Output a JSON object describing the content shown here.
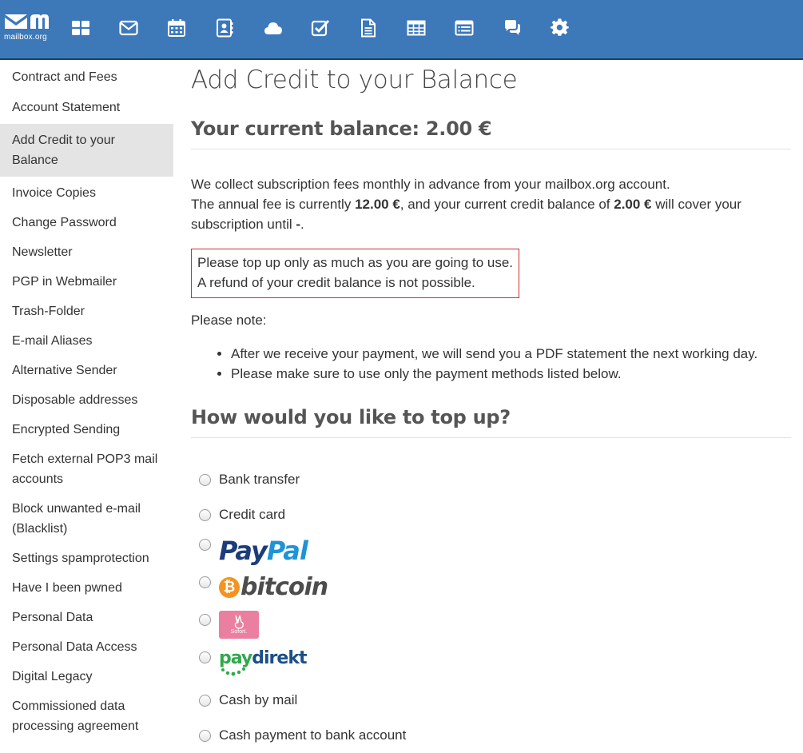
{
  "app": {
    "logo_text": "mailbox.org",
    "accent_color": "#3d78b9",
    "toolbar_icons": [
      "dashboard-icon",
      "mail-icon",
      "calendar-icon",
      "contacts-icon",
      "cloud-icon",
      "tasks-icon",
      "document-icon",
      "spreadsheet-icon",
      "presentation-icon",
      "chat-icon",
      "settings-icon"
    ]
  },
  "sidebar": {
    "items": [
      {
        "label": "Contract and Fees"
      },
      {
        "label": "Account Statement"
      },
      {
        "label": "Add Credit to your Balance",
        "active": true
      },
      {
        "label": "Invoice Copies"
      },
      {
        "label": "Change Password"
      },
      {
        "label": "Newsletter"
      },
      {
        "label": "PGP in Webmailer"
      },
      {
        "label": "Trash-Folder"
      },
      {
        "label": "E-mail Aliases"
      },
      {
        "label": "Alternative Sender"
      },
      {
        "label": "Disposable addresses"
      },
      {
        "label": "Encrypted Sending"
      },
      {
        "label": "Fetch external POP3 mail accounts"
      },
      {
        "label": "Block unwanted e-mail (Blacklist)"
      },
      {
        "label": "Settings spamprotection"
      },
      {
        "label": "Have I been pwned"
      },
      {
        "label": "Personal Data"
      },
      {
        "label": "Personal Data Access"
      },
      {
        "label": "Digital Legacy"
      },
      {
        "label": "Commissioned data processing agreement"
      }
    ]
  },
  "main": {
    "title": "Add Credit to your Balance",
    "balance_heading": "Your current balance: 2.00 €",
    "intro_line1": "We collect subscription fees monthly in advance from your mailbox.org account.",
    "intro_line2_a": "The annual fee is currently ",
    "annual_fee": "12.00 €",
    "intro_line2_b": ", and your current credit balance of ",
    "credit_balance": "2.00 €",
    "intro_line2_c": " will cover your subscription until ",
    "until_value": "-",
    "intro_line2_d": ".",
    "warning_line1": "Please top up only as much as you are going to use.",
    "warning_line2": "A refund of your credit balance is not possible.",
    "note_label": "Please note:",
    "bullets": [
      "After we receive your payment, we will send you a PDF statement the next working day.",
      "Please make sure to use only the payment methods listed below."
    ],
    "topup_heading": "How would you like to top up?",
    "payment_options": {
      "bank_transfer": "Bank transfer",
      "credit_card": "Credit card",
      "paypal_logo": "PayPal",
      "bitcoin_logo": "bitcoin",
      "sofort_logo": "Sofort.",
      "paydirekt_logo": "paydirekt",
      "cash_by_mail": "Cash by mail",
      "cash_to_bank": "Cash payment to bank account"
    }
  }
}
